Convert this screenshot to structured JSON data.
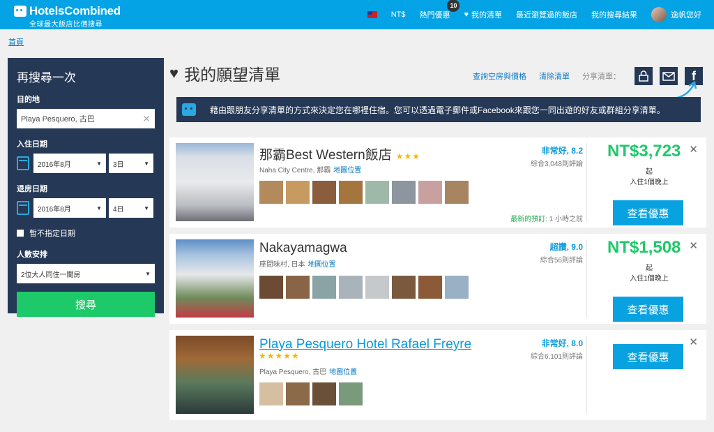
{
  "header": {
    "logo_name": "HotelsCombined",
    "logo_tagline": "全球最大飯店比價搜尋",
    "currency": "NT$",
    "hot_deals": "熱門優惠",
    "hot_deals_count": "10",
    "my_list": "我的清單",
    "recently_viewed": "最近瀏覽過的飯店",
    "my_searches": "我的搜尋結果",
    "user": "逸帆您好"
  },
  "breadcrumb": "首頁",
  "search": {
    "title": "再搜尋一次",
    "destination_label": "目的地",
    "destination_value": "Playa Pesquero, 古巴",
    "checkin_label": "入住日期",
    "checkin_month": "2016年8月",
    "checkin_day": "3日",
    "checkout_label": "退房日期",
    "checkout_month": "2016年8月",
    "checkout_day": "4日",
    "no_dates": "暫不指定日期",
    "guests_label": "人數安排",
    "guests_value": "2位大人同住一間房",
    "button": "搜尋"
  },
  "wishlist": {
    "title": "我的願望清單",
    "check_rooms": "查詢空房與價格",
    "clear": "清除清單",
    "share_label": "分享清單：",
    "info": "藉由跟朋友分享清單的方式來決定您在哪裡住宿。您可以透過電子郵件或Facebook來跟您一同出遊的好友或群組分享清單。"
  },
  "hotels": [
    {
      "name": "那霸Best Western飯店",
      "stars": "★★★",
      "location": "Naha City Centre, 那霸",
      "map": "地圖位置",
      "rating": "非常好, 8.2",
      "reviews": "綜合3,048則評論",
      "recent_label": "最新的預訂:",
      "recent_time": " 1 小時之前",
      "price": "NT$3,723",
      "price_from": "起",
      "price_note": "入住1個晚上",
      "deal": "查看優惠"
    },
    {
      "name": "Nakayamagwa",
      "stars": "",
      "location": "座間味村, 日本",
      "map": "地圖位置",
      "rating": "超讚, 9.0",
      "reviews": "綜合56則評論",
      "price": "NT$1,508",
      "price_from": "起",
      "price_note": "入住1個晚上",
      "deal": "查看優惠"
    },
    {
      "name": "Playa Pesquero Hotel Rafael Freyre",
      "stars": "★★★★★",
      "location": "Playa Pesquero, 古巴",
      "map": "地圖位置",
      "rating": "非常好, 8.0",
      "reviews": "綜合6,101則評論",
      "deal": "查看優惠"
    }
  ],
  "colors": {
    "brand": "#03a3e6",
    "navy": "#253856",
    "green": "#1ec96a"
  }
}
